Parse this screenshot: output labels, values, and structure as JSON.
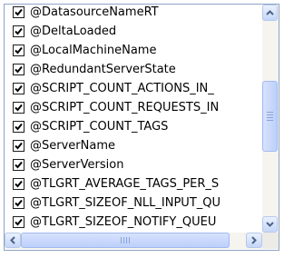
{
  "listbox": {
    "items": [
      {
        "label": "@DatasourceNameRT",
        "checked": true
      },
      {
        "label": "@DeltaLoaded",
        "checked": true
      },
      {
        "label": "@LocalMachineName",
        "checked": true
      },
      {
        "label": "@RedundantServerState",
        "checked": true
      },
      {
        "label": "@SCRIPT_COUNT_ACTIONS_IN_",
        "checked": true
      },
      {
        "label": "@SCRIPT_COUNT_REQUESTS_IN",
        "checked": true
      },
      {
        "label": "@SCRIPT_COUNT_TAGS",
        "checked": true
      },
      {
        "label": "@ServerName",
        "checked": true
      },
      {
        "label": "@ServerVersion",
        "checked": true
      },
      {
        "label": "@TLGRT_AVERAGE_TAGS_PER_S",
        "checked": true
      },
      {
        "label": "@TLGRT_SIZEOF_NLL_INPUT_QU",
        "checked": true
      },
      {
        "label": "@TLGRT_SIZEOF_NOTIFY_QUEU",
        "checked": true
      }
    ]
  },
  "icons": {
    "checkbox": "check-icon",
    "scroll_up": "arrow-up-icon",
    "scroll_down": "arrow-down-icon",
    "scroll_left": "arrow-left-icon",
    "scroll_right": "arrow-right-icon"
  },
  "colors": {
    "border": "#8ea3c4",
    "check": "#1f8c1f",
    "arrow": "#4d6185",
    "scroll_track": "#f5f4ef"
  }
}
